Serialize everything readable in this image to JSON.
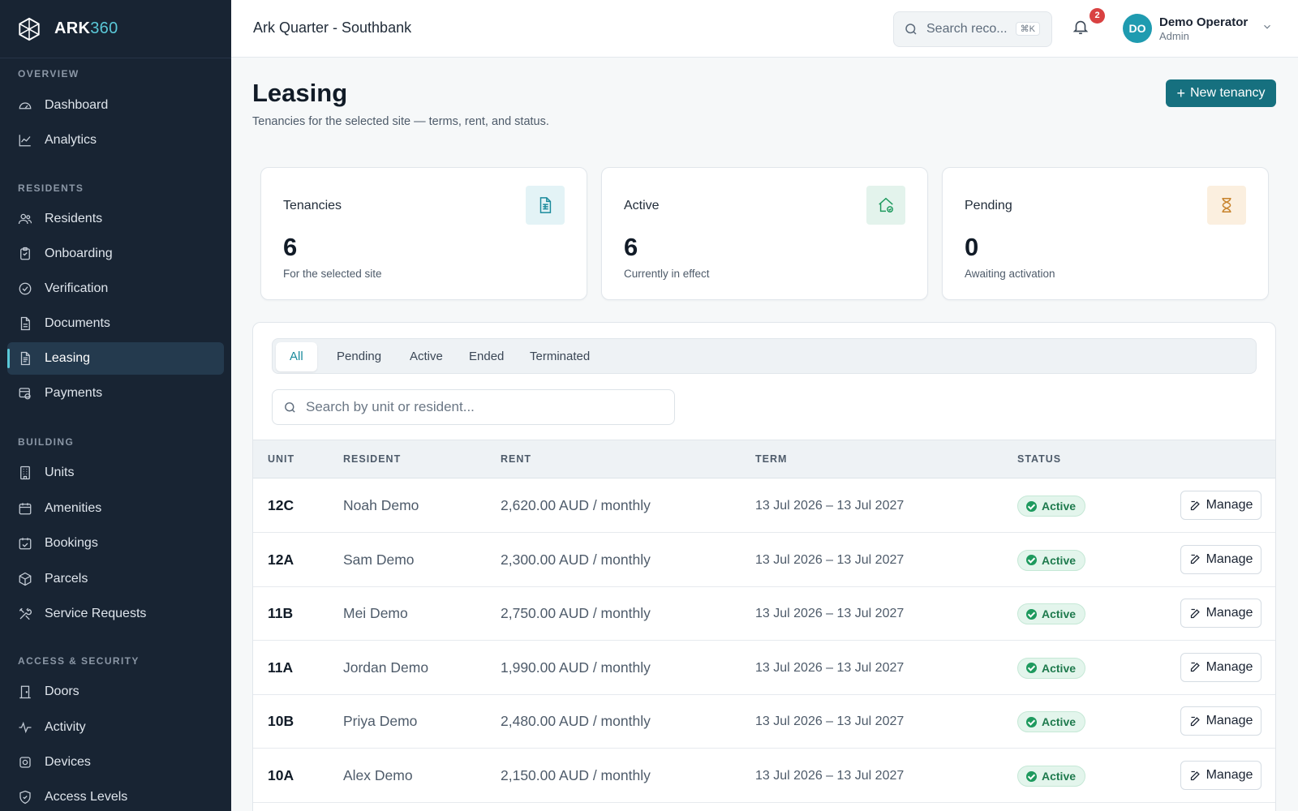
{
  "brand": {
    "name_bold": "ARK",
    "name_thin": "360"
  },
  "sidebar": {
    "sections": [
      {
        "title": "OVERVIEW",
        "items": [
          {
            "label": "Dashboard",
            "icon": "dashboard-icon"
          },
          {
            "label": "Analytics",
            "icon": "analytics-icon"
          }
        ]
      },
      {
        "title": "RESIDENTS",
        "items": [
          {
            "label": "Residents",
            "icon": "users-icon"
          },
          {
            "label": "Onboarding",
            "icon": "clipboard-icon"
          },
          {
            "label": "Verification",
            "icon": "check-circle-icon"
          },
          {
            "label": "Documents",
            "icon": "document-icon"
          },
          {
            "label": "Leasing",
            "icon": "file-text-icon",
            "active": true
          },
          {
            "label": "Payments",
            "icon": "payments-icon"
          }
        ]
      },
      {
        "title": "BUILDING",
        "items": [
          {
            "label": "Units",
            "icon": "building-icon"
          },
          {
            "label": "Amenities",
            "icon": "calendar-icon"
          },
          {
            "label": "Bookings",
            "icon": "calendar-check-icon"
          },
          {
            "label": "Parcels",
            "icon": "package-icon"
          },
          {
            "label": "Service Requests",
            "icon": "tools-icon"
          }
        ]
      },
      {
        "title": "ACCESS & SECURITY",
        "items": [
          {
            "label": "Doors",
            "icon": "door-icon"
          },
          {
            "label": "Activity",
            "icon": "activity-icon"
          },
          {
            "label": "Devices",
            "icon": "device-icon"
          },
          {
            "label": "Access Levels",
            "icon": "shield-icon"
          }
        ]
      }
    ]
  },
  "topbar": {
    "site_title": "Ark Quarter - Southbank",
    "search_placeholder": "Search reco...",
    "search_shortcut": "⌘K",
    "notification_count": "2",
    "user_initials": "DO",
    "user_name": "Demo Operator",
    "user_role": "Admin"
  },
  "page": {
    "title": "Leasing",
    "subtitle": "Tenancies for the selected site — terms, rent, and status.",
    "new_button": "New tenancy"
  },
  "cards": [
    {
      "title": "Tenancies",
      "value": "6",
      "sub": "For the selected site",
      "icon": "document-icon",
      "accent": "#1a8a9c",
      "bg": "#e3f3f6"
    },
    {
      "title": "Active",
      "value": "6",
      "sub": "Currently in effect",
      "icon": "home-check-icon",
      "accent": "#1e9a5e",
      "bg": "#e3f3ec"
    },
    {
      "title": "Pending",
      "value": "0",
      "sub": "Awaiting activation",
      "icon": "hourglass-icon",
      "accent": "#c7822a",
      "bg": "#fbefdf"
    }
  ],
  "tabs": [
    "All",
    "Pending",
    "Active",
    "Ended",
    "Terminated"
  ],
  "active_tab": "All",
  "table_search_placeholder": "Search by unit or resident...",
  "table": {
    "columns": [
      "UNIT",
      "RESIDENT",
      "RENT",
      "TERM",
      "STATUS"
    ],
    "rows": [
      {
        "unit": "12C",
        "resident": "Noah Demo",
        "rent": "2,620.00 AUD / monthly",
        "term": "13 Jul 2026 – 13 Jul 2027",
        "status": "Active",
        "action": "Manage"
      },
      {
        "unit": "12A",
        "resident": "Sam Demo",
        "rent": "2,300.00 AUD / monthly",
        "term": "13 Jul 2026 – 13 Jul 2027",
        "status": "Active",
        "action": "Manage"
      },
      {
        "unit": "11B",
        "resident": "Mei Demo",
        "rent": "2,750.00 AUD / monthly",
        "term": "13 Jul 2026 – 13 Jul 2027",
        "status": "Active",
        "action": "Manage"
      },
      {
        "unit": "11A",
        "resident": "Jordan Demo",
        "rent": "1,990.00 AUD / monthly",
        "term": "13 Jul 2026 – 13 Jul 2027",
        "status": "Active",
        "action": "Manage"
      },
      {
        "unit": "10B",
        "resident": "Priya Demo",
        "rent": "2,480.00 AUD / monthly",
        "term": "13 Jul 2026 – 13 Jul 2027",
        "status": "Active",
        "action": "Manage"
      },
      {
        "unit": "10A",
        "resident": "Alex Demo",
        "rent": "2,150.00 AUD / monthly",
        "term": "13 Jul 2026 – 13 Jul 2027",
        "status": "Active",
        "action": "Manage"
      }
    ]
  },
  "colors": {
    "sidebar_bg": "#182433",
    "accent": "#16707f",
    "active_green": "#1e9a5e"
  }
}
